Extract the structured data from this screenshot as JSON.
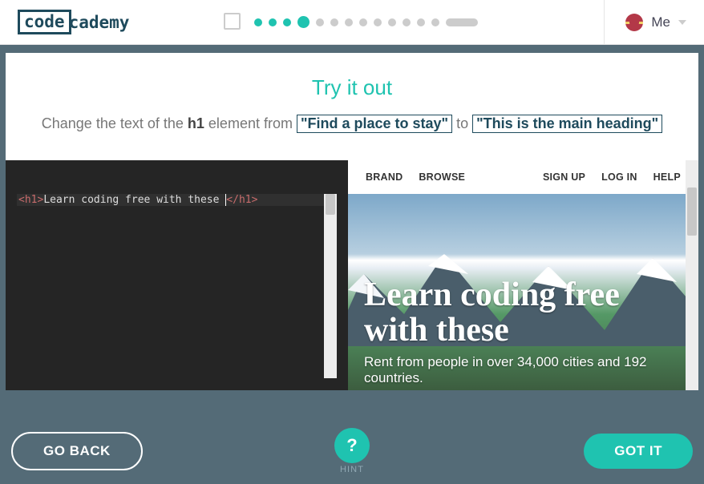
{
  "header": {
    "logo_part1": "code",
    "logo_part2": "cademy",
    "me_label": "Me"
  },
  "instruction": {
    "title": "Try it out",
    "prefix": "Change the text of the ",
    "element_name": "h1",
    "middle": " element from ",
    "from_text": "\"Find a place to stay\"",
    "connector": " to ",
    "to_text": "\"This is the main heading\""
  },
  "editor": {
    "open_tag": "<h1>",
    "content": "Learn coding free with these ",
    "close_tag": "</h1>"
  },
  "preview": {
    "nav": {
      "brand": "BRAND",
      "browse": "BROWSE",
      "signup": "SIGN UP",
      "login": "LOG IN",
      "help": "HELP"
    },
    "hero_heading": "Learn coding free with these",
    "hero_sub": "Rent from people in over 34,000 cities and 192 countries."
  },
  "footer": {
    "back": "GO BACK",
    "hint_symbol": "?",
    "hint_label": "HINT",
    "gotit": "GOT IT"
  }
}
